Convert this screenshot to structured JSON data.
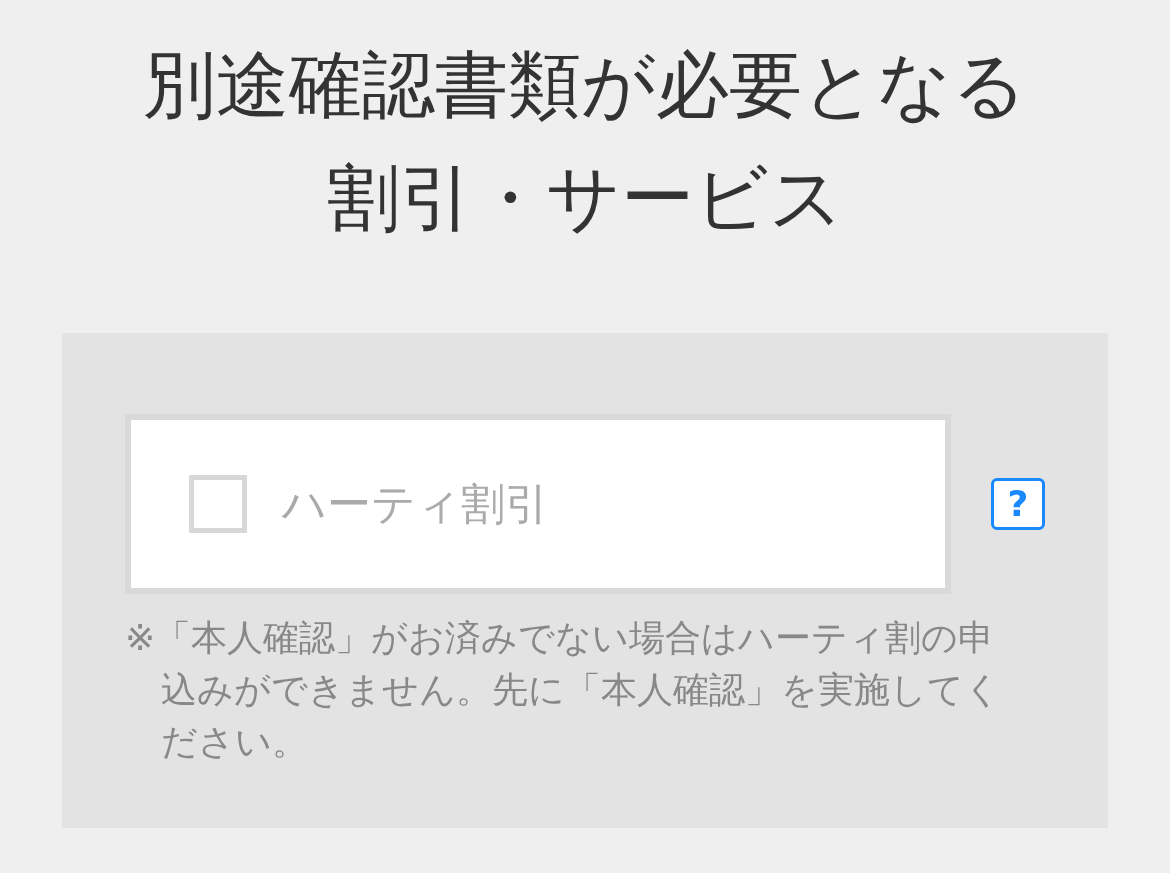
{
  "title": "別途確認書類が必要となる割引・サービス",
  "options": [
    {
      "label": "ハーティ割引",
      "checked": false,
      "disabled": true,
      "help": "?",
      "note": "※「本人確認」がお済みでない場合はハーティ割の申込みができません。先に「本人確認」を実施してください。"
    }
  ]
}
